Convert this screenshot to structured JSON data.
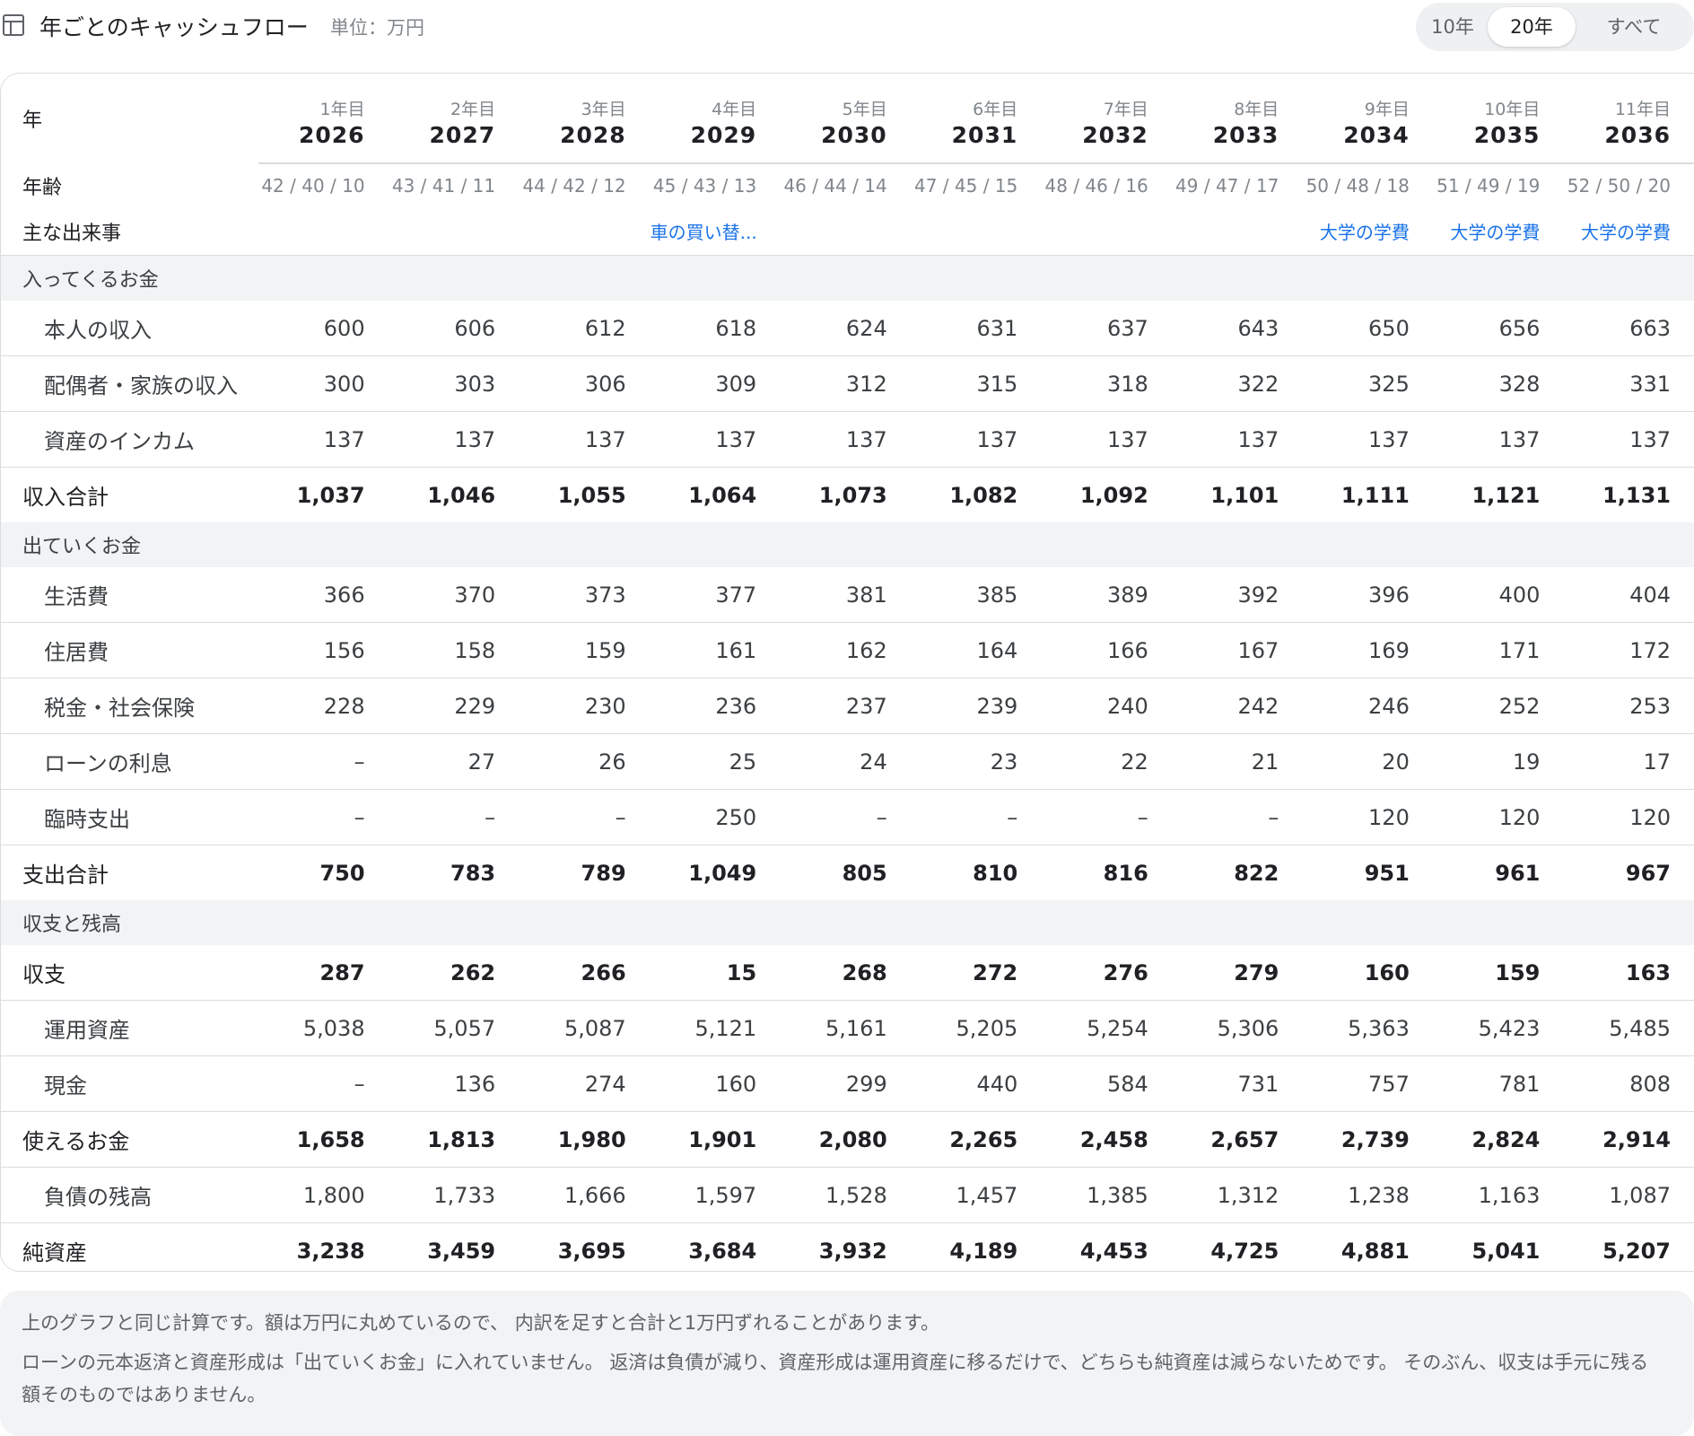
{
  "header": {
    "title": "年ごとのキャッシュフロー",
    "unit": "単位：万円",
    "range_options": [
      "10年",
      "20年",
      "すべて"
    ],
    "range_selected": "20年"
  },
  "table": {
    "label_year": "年",
    "label_age": "年齢",
    "label_event": "主な出来事",
    "years": [
      {
        "idx": "1年目",
        "year": "2026",
        "age": "42 / 40 / 10",
        "event": ""
      },
      {
        "idx": "2年目",
        "year": "2027",
        "age": "43 / 41 / 11",
        "event": ""
      },
      {
        "idx": "3年目",
        "year": "2028",
        "age": "44 / 42 / 12",
        "event": ""
      },
      {
        "idx": "4年目",
        "year": "2029",
        "age": "45 / 43 / 13",
        "event": "車の買い替..."
      },
      {
        "idx": "5年目",
        "year": "2030",
        "age": "46 / 44 / 14",
        "event": ""
      },
      {
        "idx": "6年目",
        "year": "2031",
        "age": "47 / 45 / 15",
        "event": ""
      },
      {
        "idx": "7年目",
        "year": "2032",
        "age": "48 / 46 / 16",
        "event": ""
      },
      {
        "idx": "8年目",
        "year": "2033",
        "age": "49 / 47 / 17",
        "event": ""
      },
      {
        "idx": "9年目",
        "year": "2034",
        "age": "50 / 48 / 18",
        "event": "大学の学費"
      },
      {
        "idx": "10年目",
        "year": "2035",
        "age": "51 / 49 / 19",
        "event": "大学の学費"
      },
      {
        "idx": "11年目",
        "year": "2036",
        "age": "52 / 50 / 20",
        "event": "大学の学費"
      }
    ],
    "sections": [
      {
        "title": "入ってくるお金",
        "rows": [
          {
            "label": "本人の収入",
            "kind": "line",
            "values": [
              "600",
              "606",
              "612",
              "618",
              "624",
              "631",
              "637",
              "643",
              "650",
              "656",
              "663"
            ]
          },
          {
            "label": "配偶者・家族の収入",
            "kind": "line",
            "values": [
              "300",
              "303",
              "306",
              "309",
              "312",
              "315",
              "318",
              "322",
              "325",
              "328",
              "331"
            ]
          },
          {
            "label": "資産のインカム",
            "kind": "line",
            "values": [
              "137",
              "137",
              "137",
              "137",
              "137",
              "137",
              "137",
              "137",
              "137",
              "137",
              "137"
            ]
          },
          {
            "label": "収入合計",
            "kind": "total",
            "values": [
              "1,037",
              "1,046",
              "1,055",
              "1,064",
              "1,073",
              "1,082",
              "1,092",
              "1,101",
              "1,111",
              "1,121",
              "1,131"
            ]
          }
        ]
      },
      {
        "title": "出ていくお金",
        "rows": [
          {
            "label": "生活費",
            "kind": "line",
            "values": [
              "366",
              "370",
              "373",
              "377",
              "381",
              "385",
              "389",
              "392",
              "396",
              "400",
              "404"
            ]
          },
          {
            "label": "住居費",
            "kind": "line",
            "values": [
              "156",
              "158",
              "159",
              "161",
              "162",
              "164",
              "166",
              "167",
              "169",
              "171",
              "172"
            ]
          },
          {
            "label": "税金・社会保険",
            "kind": "line",
            "values": [
              "228",
              "229",
              "230",
              "236",
              "237",
              "239",
              "240",
              "242",
              "246",
              "252",
              "253"
            ]
          },
          {
            "label": "ローンの利息",
            "kind": "line",
            "values": [
              "–",
              "27",
              "26",
              "25",
              "24",
              "23",
              "22",
              "21",
              "20",
              "19",
              "17"
            ]
          },
          {
            "label": "臨時支出",
            "kind": "line",
            "values": [
              "–",
              "–",
              "–",
              "250",
              "–",
              "–",
              "–",
              "–",
              "120",
              "120",
              "120"
            ]
          },
          {
            "label": "支出合計",
            "kind": "total",
            "values": [
              "750",
              "783",
              "789",
              "1,049",
              "805",
              "810",
              "816",
              "822",
              "951",
              "961",
              "967"
            ]
          }
        ]
      },
      {
        "title": "収支と残高",
        "rows": [
          {
            "label": "収支",
            "kind": "total-bb",
            "values": [
              "287",
              "262",
              "266",
              "15",
              "268",
              "272",
              "276",
              "279",
              "160",
              "159",
              "163"
            ]
          },
          {
            "label": "運用資産",
            "kind": "line",
            "values": [
              "5,038",
              "5,057",
              "5,087",
              "5,121",
              "5,161",
              "5,205",
              "5,254",
              "5,306",
              "5,363",
              "5,423",
              "5,485"
            ]
          },
          {
            "label": "現金",
            "kind": "line",
            "values": [
              "–",
              "136",
              "274",
              "160",
              "299",
              "440",
              "584",
              "731",
              "757",
              "781",
              "808"
            ]
          },
          {
            "label": "使えるお金",
            "kind": "total-bb",
            "values": [
              "1,658",
              "1,813",
              "1,980",
              "1,901",
              "2,080",
              "2,265",
              "2,458",
              "2,657",
              "2,739",
              "2,824",
              "2,914"
            ]
          },
          {
            "label": "負債の残高",
            "kind": "line",
            "values": [
              "1,800",
              "1,733",
              "1,666",
              "1,597",
              "1,528",
              "1,457",
              "1,385",
              "1,312",
              "1,238",
              "1,163",
              "1,087"
            ]
          },
          {
            "label": "純資産",
            "kind": "total",
            "values": [
              "3,238",
              "3,459",
              "3,695",
              "3,684",
              "3,932",
              "4,189",
              "4,453",
              "4,725",
              "4,881",
              "5,041",
              "5,207"
            ]
          }
        ]
      }
    ]
  },
  "notes": [
    "上のグラフと同じ計算です。額は万円に丸めているので、 内訳を足すと合計と1万円ずれることがあります。",
    "ローンの元本返済と資産形成は「出ていくお金」に入れていません。 返済は負債が減り、資産形成は運用資産に移るだけで、どちらも純資産は減らないためです。 そのぶん、収支は手元に残る額そのものではありません。"
  ]
}
